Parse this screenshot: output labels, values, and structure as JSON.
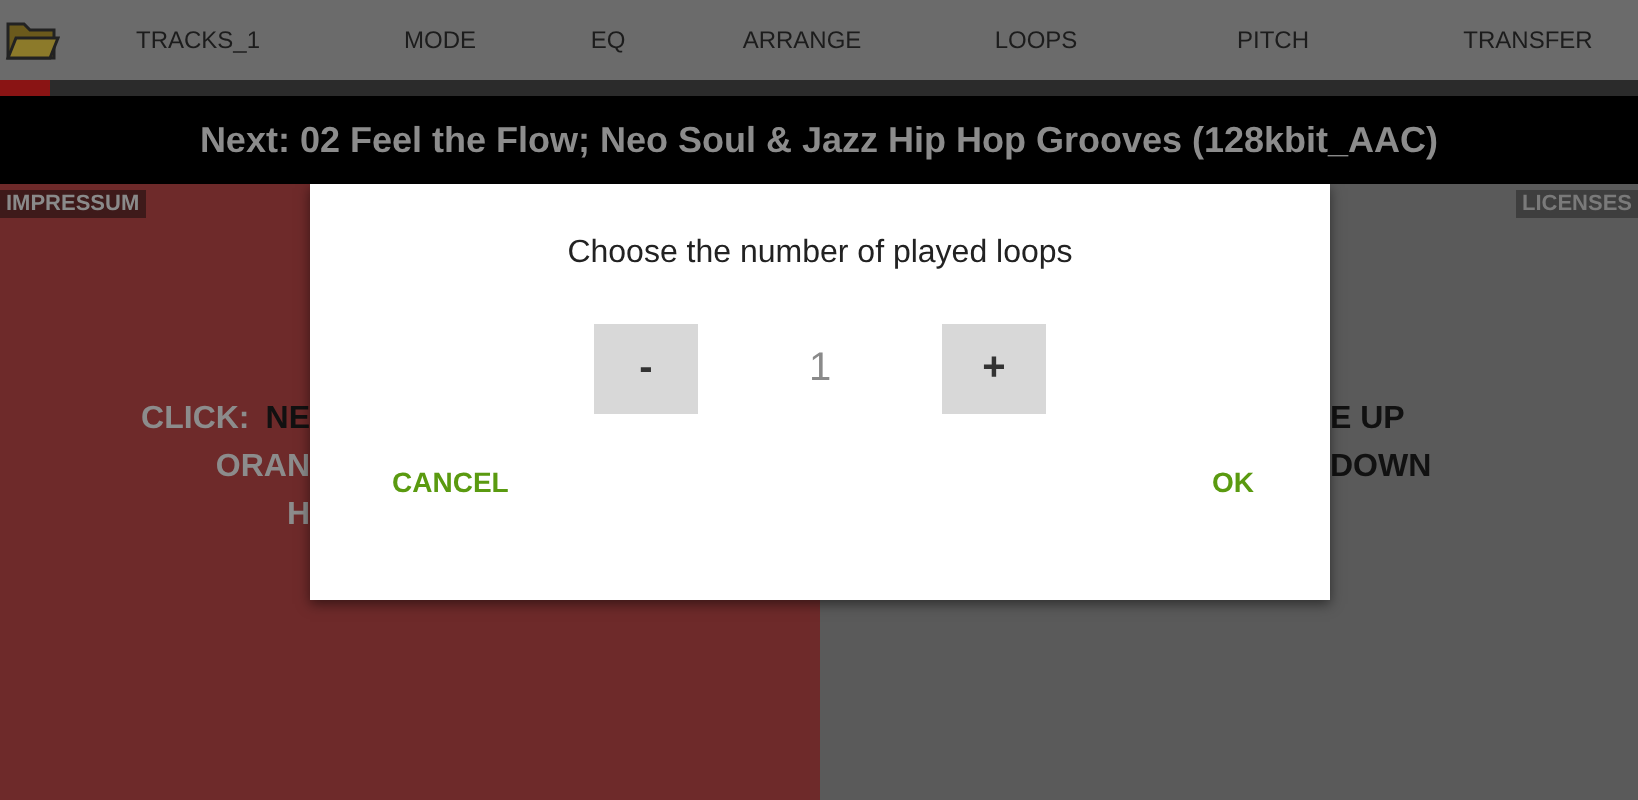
{
  "toolbar": {
    "tabs": [
      {
        "label": "TRACKS_1"
      },
      {
        "label": "MODE"
      },
      {
        "label": "EQ"
      },
      {
        "label": "ARRANGE"
      },
      {
        "label": "LOOPS"
      },
      {
        "label": "PITCH"
      },
      {
        "label": "TRANSFER"
      }
    ]
  },
  "progress": {
    "level": 0.03
  },
  "next_banner": "Next: 02 Feel the Flow; Neo Soul & Jazz Hip Hop Grooves (128kbit_AAC)",
  "left_panel": {
    "label": "IMPRESSUM",
    "lines": [
      [
        {
          "text": "CLICK:",
          "kind": "key"
        },
        {
          "text": "NE",
          "kind": "action"
        }
      ],
      [
        {
          "text": "ORAN",
          "kind": "key"
        }
      ],
      [
        {
          "text": "H",
          "kind": "key"
        }
      ]
    ]
  },
  "right_panel": {
    "label": "LICENSES",
    "lines": [
      [
        {
          "text": "E UP",
          "kind": "action"
        }
      ],
      [
        {
          "text": "DOWN",
          "kind": "action"
        }
      ]
    ]
  },
  "dialog": {
    "title": "Choose the number of played loops",
    "decrement": "-",
    "value": "1",
    "increment": "+",
    "buttons": [
      "CANCEL",
      "OK"
    ]
  }
}
